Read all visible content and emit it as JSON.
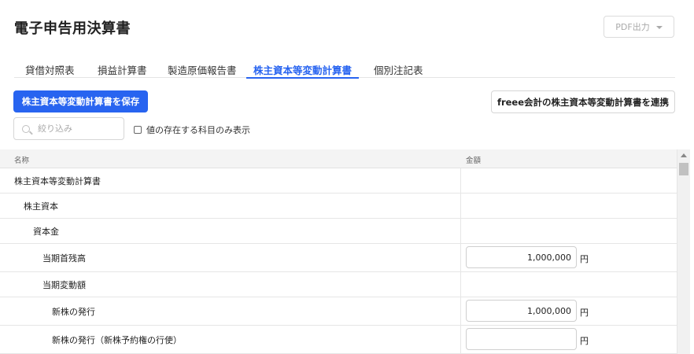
{
  "page": {
    "title": "電子申告用決算書"
  },
  "pdf_button": {
    "label": "PDF出力"
  },
  "tabs": [
    {
      "label": "貸借対照表",
      "active": false
    },
    {
      "label": "損益計算書",
      "active": false
    },
    {
      "label": "製造原価報告書",
      "active": false
    },
    {
      "label": "株主資本等変動計算書",
      "active": true
    },
    {
      "label": "個別注記表",
      "active": false
    }
  ],
  "actions": {
    "save_label": "株主資本等変動計算書を保存",
    "link_label": "freee会計の株主資本等変動計算書を連携"
  },
  "filter": {
    "placeholder": "絞り込み",
    "value": "",
    "checkbox_label": "値の存在する科目のみ表示",
    "checked": false
  },
  "table": {
    "headers": {
      "name": "名称",
      "amount": "金額"
    },
    "currency": "円",
    "rows": [
      {
        "name": "株主資本等変動計算書",
        "level": 0,
        "has_input": false,
        "value": ""
      },
      {
        "name": "株主資本",
        "level": 1,
        "has_input": false,
        "value": ""
      },
      {
        "name": "資本金",
        "level": 2,
        "has_input": false,
        "value": ""
      },
      {
        "name": "当期首残高",
        "level": 3,
        "has_input": true,
        "value": "1,000,000"
      },
      {
        "name": "当期変動額",
        "level": 3,
        "has_input": false,
        "value": ""
      },
      {
        "name": "新株の発行",
        "level": 4,
        "has_input": true,
        "value": "1,000,000"
      },
      {
        "name": "新株の発行（新株予約権の行使）",
        "level": 4,
        "has_input": true,
        "value": ""
      }
    ]
  },
  "colors": {
    "accent": "#2864f0",
    "header_bg": "#f4f4f4",
    "border": "#e6e6e6"
  }
}
